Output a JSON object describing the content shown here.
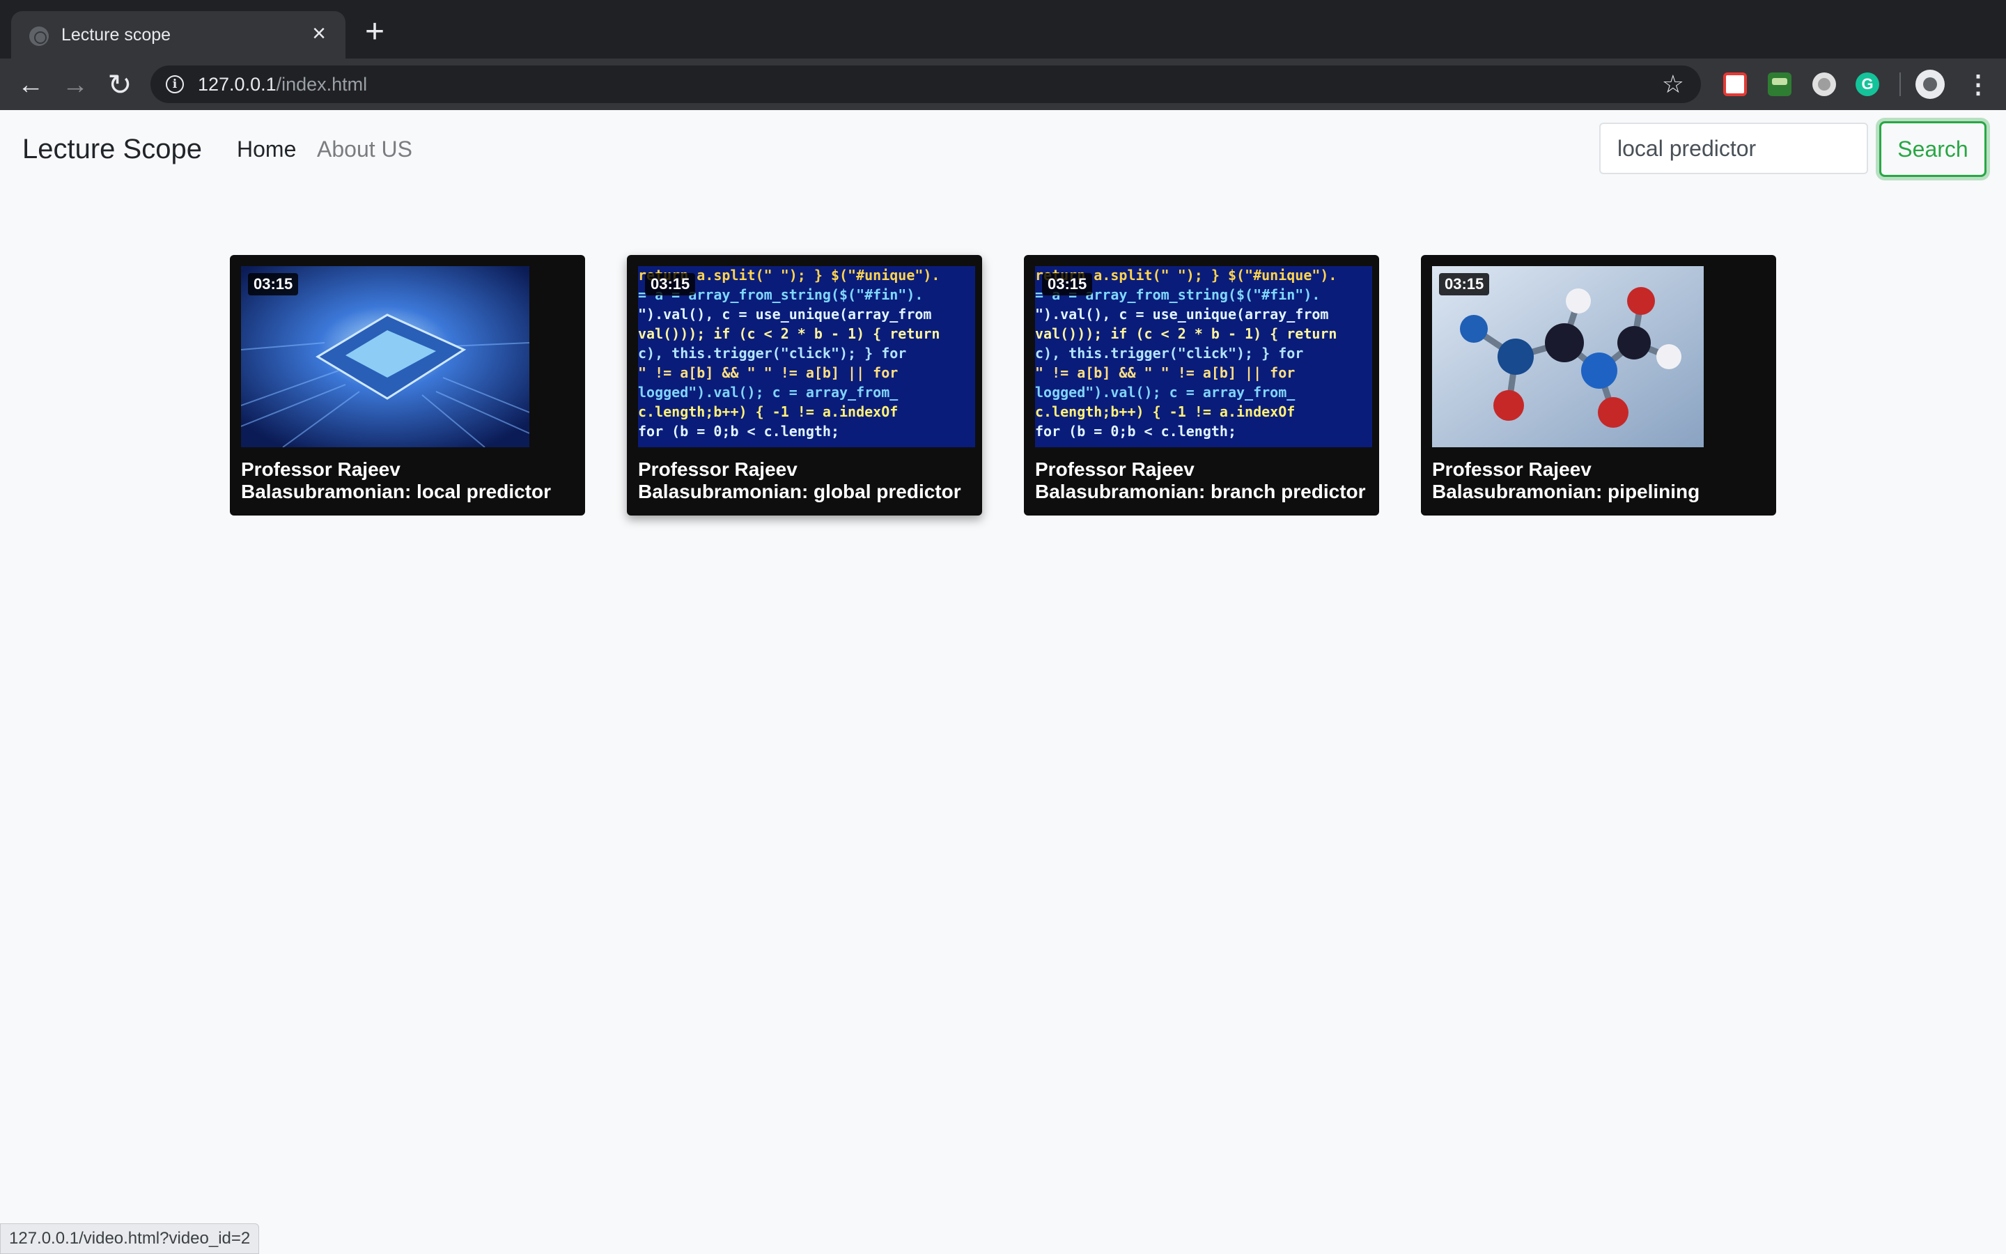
{
  "browser": {
    "tab_title": "Lecture scope",
    "url_host": "127.0.0.1",
    "url_path": "/index.html",
    "status_url": "127.0.0.1/video.html?video_id=2"
  },
  "site": {
    "brand": "Lecture Scope",
    "nav": [
      {
        "label": "Home",
        "active": true
      },
      {
        "label": "About US",
        "active": false
      }
    ],
    "search": {
      "value": "local predictor",
      "button_label": "Search"
    }
  },
  "videos": [
    {
      "duration": "03:15",
      "title": "Professor Rajeev Balasubramonian: local predictor",
      "thumbnail": "cpu-chip"
    },
    {
      "duration": "03:15",
      "title": "Professor Rajeev Balasubramonian: global predictor",
      "thumbnail": "code-screen"
    },
    {
      "duration": "03:15",
      "title": "Professor Rajeev Balasubramonian: branch predictor",
      "thumbnail": "code-screen"
    },
    {
      "duration": "03:15",
      "title": "Professor Rajeev Balasubramonian: pipelining",
      "thumbnail": "molecule"
    }
  ],
  "colors": {
    "search_accent": "#28a745",
    "card_bg": "#0e0e0e",
    "page_bg": "#f8f9fa"
  }
}
